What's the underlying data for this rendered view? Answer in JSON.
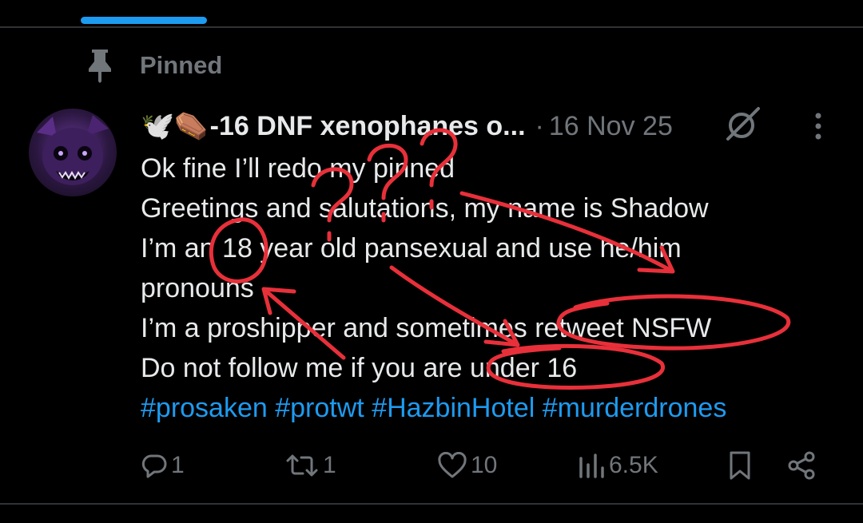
{
  "pinned": {
    "label": "Pinned"
  },
  "post": {
    "author_emojis": "🕊️⚰️",
    "display_name": "-16 DNF xenophanes o...",
    "separator": "·",
    "date": "16 Nov 25",
    "lines": [
      "Ok fine I’ll redo my pinned",
      "Greetings and salutations, my name is Shadow",
      "I’m an 18 year old pansexual and use he/him",
      "pronouns",
      "I’m a proshipper and sometimes retweet NSFW",
      "Do not follow me if you are under 16"
    ],
    "hashtags": [
      "#prosaken",
      "#protwt",
      "#HazbinHotel",
      "#murderdrones"
    ]
  },
  "actions": {
    "replies": "1",
    "reposts": "1",
    "likes": "10",
    "views": "6.5K"
  },
  "colors": {
    "background": "#000000",
    "text": "#e7e9ea",
    "muted": "#71767b",
    "accent": "#1d9bf0",
    "annotation": "#e8303a"
  },
  "icons": [
    "pin-icon",
    "grok-icon",
    "more-icon",
    "reply-icon",
    "repost-icon",
    "like-icon",
    "views-icon",
    "bookmark-icon",
    "share-icon"
  ]
}
